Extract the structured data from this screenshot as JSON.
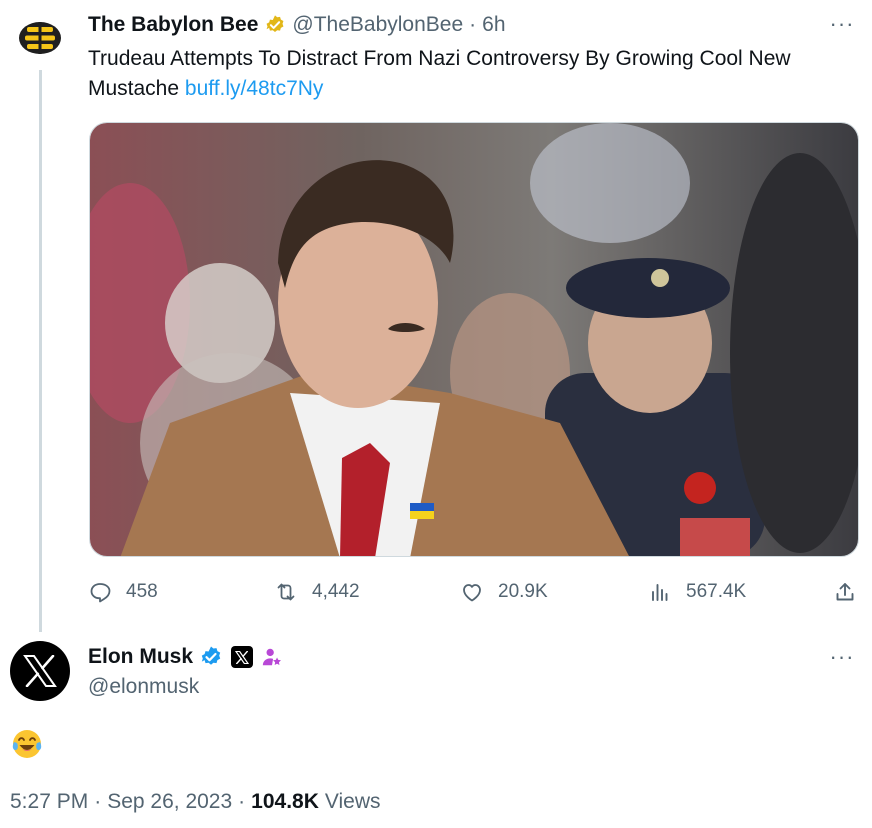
{
  "parent_tweet": {
    "author_name": "The Babylon Bee",
    "handle": "@TheBabylonBee",
    "separator": "·",
    "time_ago": "6h",
    "more_label": "···",
    "text": "Trudeau Attempts To Distract From Nazi Controversy By Growing Cool New Mustache ",
    "link": "buff.ly/48tc7Ny",
    "avatar_icon": "babylon-bee-logo-icon",
    "badge_icon": "gold-verified-badge-icon",
    "actions": {
      "replies": "458",
      "retweets": "4,442",
      "likes": "20.9K",
      "views": "567.4K"
    }
  },
  "main_tweet": {
    "author_name": "Elon Musk",
    "handle": "@elonmusk",
    "more_label": "···",
    "avatar_icon": "x-logo-icon",
    "badge_icon": "blue-verified-badge-icon",
    "affiliate_icon": "x-affiliation-icon",
    "extra_icon": "person-with-star-icon",
    "body_emoji": "face-with-tears-of-joy-icon",
    "time": "5:27 PM",
    "date": "Sep 26, 2023",
    "separator": "·",
    "views_count": "104.8K",
    "views_label": "Views"
  },
  "colors": {
    "link": "#1d9bf0",
    "secondary_text": "#536471",
    "primary_text": "#0f1419",
    "verified_blue": "#1d9bf0",
    "verified_gold": "#e2b719",
    "thread_line": "#cfd9de"
  }
}
